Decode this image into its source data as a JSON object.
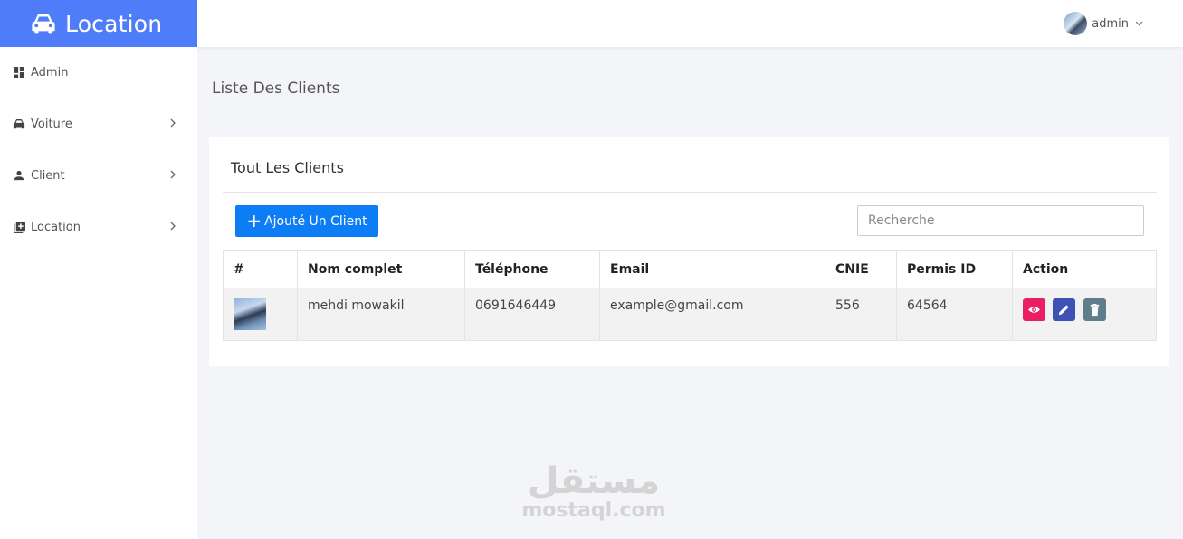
{
  "brand": {
    "title": "Location",
    "color": "#4f7df9"
  },
  "sidebar": {
    "items": [
      {
        "label": "Admin",
        "icon": "dashboard-icon",
        "has_submenu": false
      },
      {
        "label": "Voiture",
        "icon": "car-icon",
        "has_submenu": true
      },
      {
        "label": "Client",
        "icon": "person-icon",
        "has_submenu": true
      },
      {
        "label": "Location",
        "icon": "library-add-icon",
        "has_submenu": true
      }
    ]
  },
  "header": {
    "user_name": "admin"
  },
  "main": {
    "page_title": "Liste Des Clients",
    "card_title": "Tout Les Clients",
    "add_button_label": "Ajouté Un Client",
    "search_placeholder": "Recherche",
    "table": {
      "columns": [
        "#",
        "Nom complet",
        "Téléphone",
        "Email",
        "CNIE",
        "Permis ID",
        "Action"
      ],
      "rows": [
        {
          "photo": "client-photo",
          "name": "mehdi mowakil",
          "phone": "0691646449",
          "email": "example@gmail.com",
          "cnie": "556",
          "permis": "64564"
        }
      ]
    },
    "action_colors": {
      "view": "#e91e63",
      "edit": "#3f51b5",
      "delete": "#607d8b"
    }
  },
  "watermark": {
    "arabic": "مستقل",
    "latin": "mostaql.com"
  }
}
